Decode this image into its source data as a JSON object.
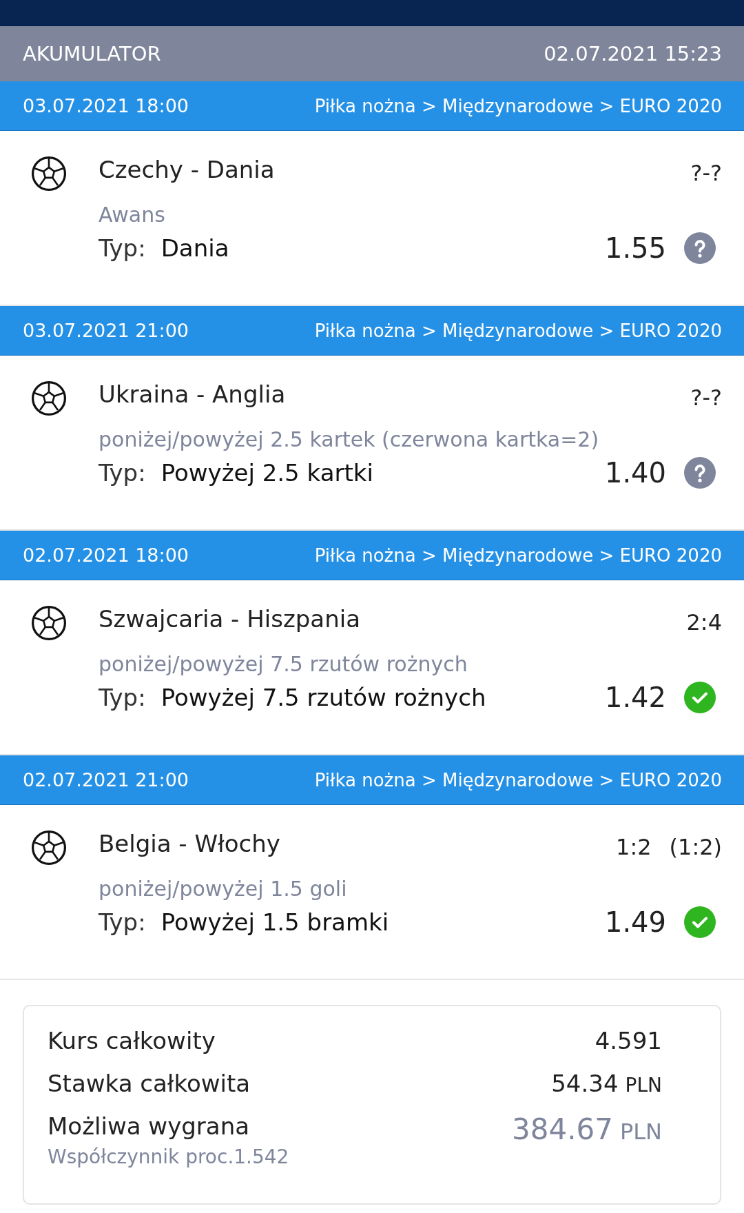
{
  "header": {
    "title": "AKUMULATOR",
    "datetime": "02.07.2021 15:23"
  },
  "events": [
    {
      "datetime": "03.07.2021 18:00",
      "category": "Piłka nożna > Międzynarodowe > EURO 2020",
      "match": "Czechy - Dania",
      "score": "?-?",
      "market": "Awans",
      "tip_label": "Typ:",
      "tip": "Dania",
      "odds": "1.55",
      "won": false
    },
    {
      "datetime": "03.07.2021 21:00",
      "category": "Piłka nożna > Międzynarodowe > EURO 2020",
      "match": "Ukraina - Anglia",
      "score": "?-?",
      "market": "poniżej/powyżej 2.5 kartek (czerwona kartka=2)",
      "tip_label": "Typ:",
      "tip": "Powyżej 2.5 kartki",
      "odds": "1.40",
      "won": false
    },
    {
      "datetime": "02.07.2021 18:00",
      "category": "Piłka nożna > Międzynarodowe > EURO 2020",
      "match": "Szwajcaria - Hiszpania",
      "score": "2:4",
      "market": "poniżej/powyżej 7.5 rzutów rożnych",
      "tip_label": "Typ:",
      "tip": "Powyżej 7.5 rzutów rożnych",
      "odds": "1.42",
      "won": true
    },
    {
      "datetime": "02.07.2021 21:00",
      "category": "Piłka nożna > Międzynarodowe > EURO 2020",
      "match": "Belgia - Włochy",
      "score": "1:2",
      "halftime": "(1:2)",
      "market": "poniżej/powyżej 1.5 goli",
      "tip_label": "Typ:",
      "tip": "Powyżej 1.5 bramki",
      "odds": "1.49",
      "won": true
    }
  ],
  "summary": {
    "rows": [
      {
        "label": "Kurs całkowity",
        "value": "4.591",
        "kind": "plain"
      },
      {
        "label": "Stawka całkowita",
        "value": "54.34",
        "currency": "PLN",
        "kind": "plain"
      },
      {
        "label": "Możliwa wygrana",
        "value": "384.67",
        "currency": "PLN",
        "kind": "highlight",
        "note": "Współczynnik proc.1.542"
      }
    ]
  }
}
